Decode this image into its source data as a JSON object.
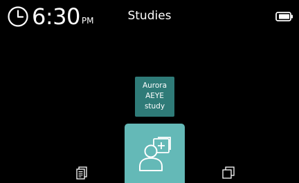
{
  "status_bar": {
    "time": "6:30",
    "ampm": "PM",
    "clock_icon": "clock-icon",
    "battery_icon": "battery-icon"
  },
  "header": {
    "title": "Studies"
  },
  "studies": [
    {
      "lines": [
        "Aurora",
        "AEYE",
        "study"
      ]
    }
  ],
  "actions": {
    "add_icon": "add-user-icon"
  },
  "nav": {
    "left_icon": "document-stack-icon",
    "right_icon": "copy-pages-icon"
  },
  "colors": {
    "background": "#000000",
    "card": "#2f7b78",
    "add_button": "#64b9b7",
    "text": "#ffffff"
  }
}
